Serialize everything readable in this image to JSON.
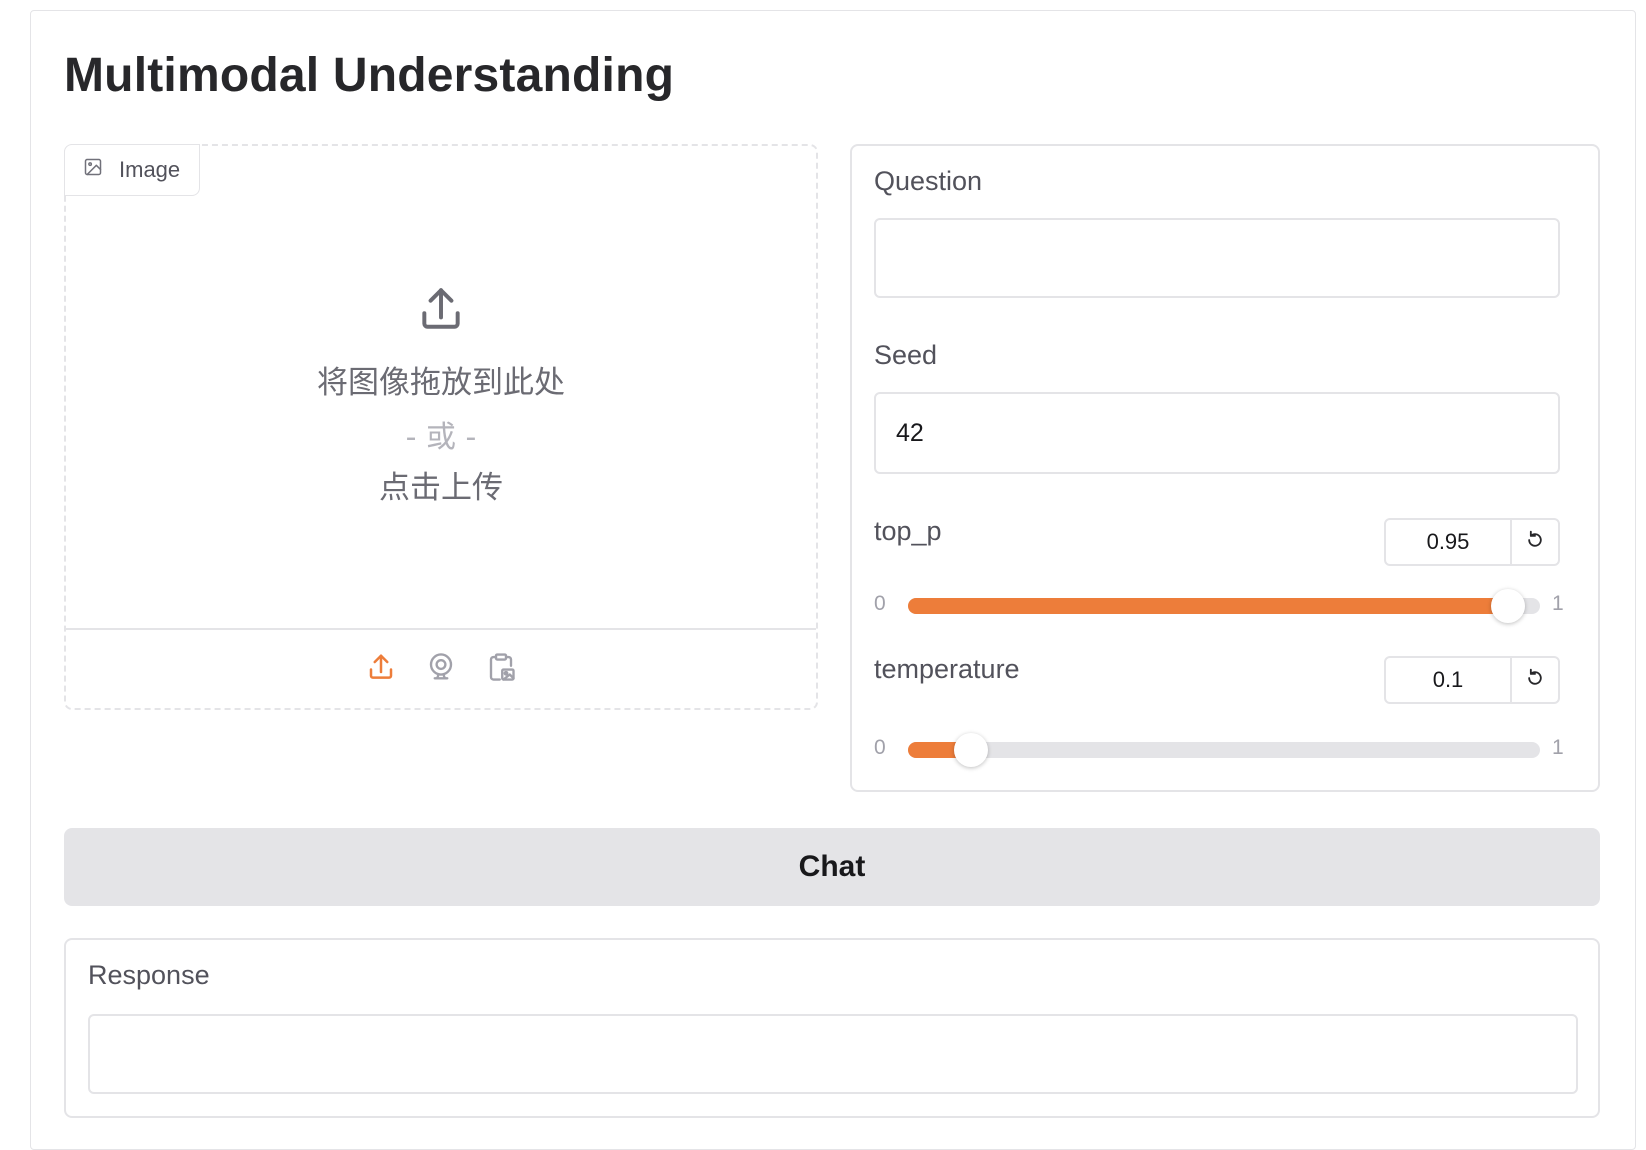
{
  "app": {
    "title": "Multimodal Understanding"
  },
  "image_input": {
    "label": "Image",
    "drop_text": "将图像拖放到此处",
    "or_text": "- 或 -",
    "click_text": "点击上传",
    "sources": [
      "upload-icon",
      "webcam-icon",
      "clipboard-icon"
    ]
  },
  "question": {
    "label": "Question",
    "value": ""
  },
  "seed": {
    "label": "Seed",
    "value": "42"
  },
  "top_p": {
    "label": "top_p",
    "value": "0.95",
    "min": "0",
    "max": "1",
    "fraction": 0.95
  },
  "temperature": {
    "label": "temperature",
    "value": "0.1",
    "min": "0",
    "max": "1",
    "fraction": 0.1
  },
  "chat_button": {
    "label": "Chat"
  },
  "response": {
    "label": "Response",
    "value": ""
  },
  "colors": {
    "accent": "#ed7d3a",
    "border": "#e4e4e7",
    "button_bg": "#e4e4e7"
  }
}
